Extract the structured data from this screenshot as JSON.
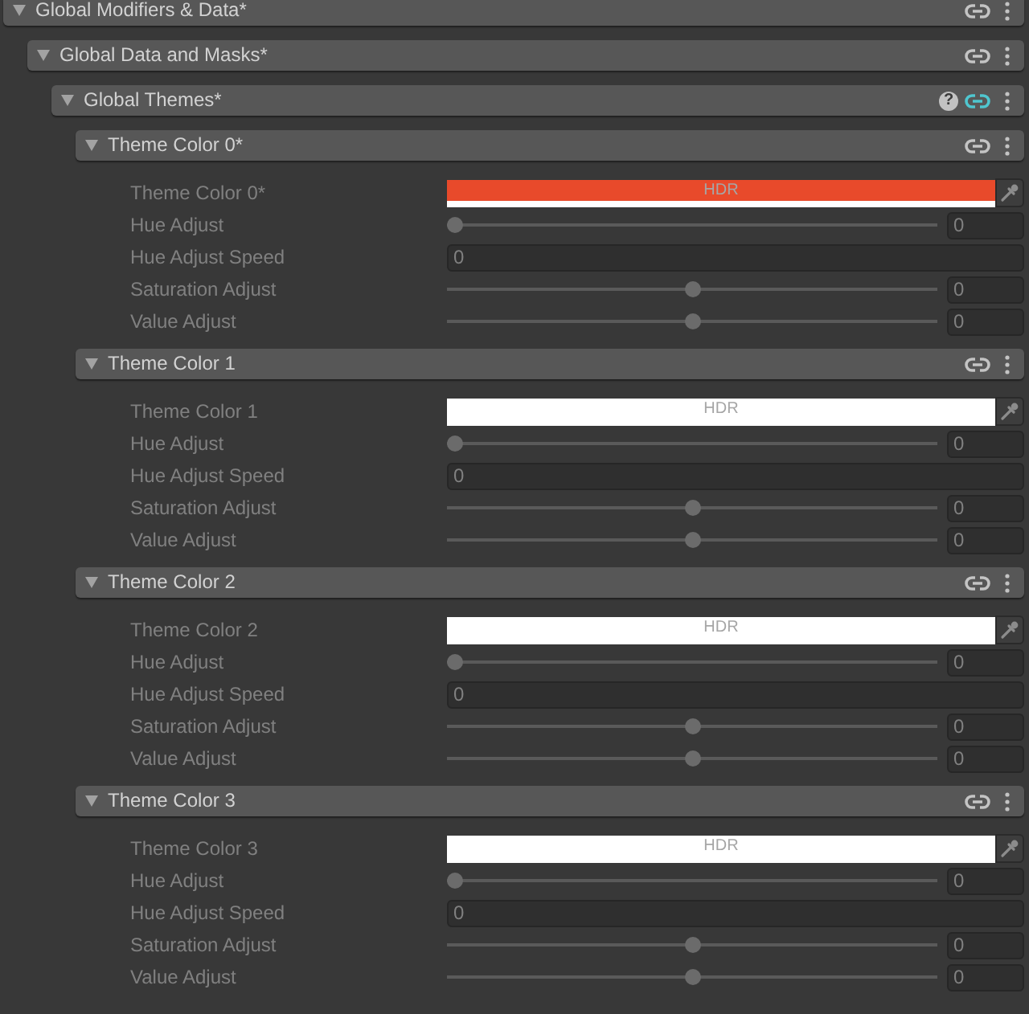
{
  "foldouts": [
    {
      "title": "Global Modifiers & Data*",
      "expanded": true,
      "linked": false,
      "children": [
        {
          "title": "Global Data and Masks*",
          "expanded": true,
          "linked": false,
          "children": [
            {
              "title": "Global Themes*",
              "expanded": true,
              "linked": true,
              "help": "?",
              "children": [
                {
                  "title": "Theme Color 0*",
                  "expanded": true,
                  "linked": false,
                  "disabled": true,
                  "properties": [
                    {
                      "kind": "color",
                      "label": "Theme Color 0*",
                      "color": "#e84a2b",
                      "badge": "HDR"
                    },
                    {
                      "kind": "slider",
                      "label": "Hue Adjust",
                      "level": 0,
                      "value": "0"
                    },
                    {
                      "kind": "number",
                      "label": "Hue Adjust Speed",
                      "value": "0"
                    },
                    {
                      "kind": "slider",
                      "label": "Saturation Adjust",
                      "level": 0.5,
                      "value": "0"
                    },
                    {
                      "kind": "slider",
                      "label": "Value Adjust",
                      "level": 0.5,
                      "value": "0"
                    }
                  ]
                },
                {
                  "title": "Theme Color 1",
                  "expanded": true,
                  "linked": false,
                  "disabled": true,
                  "properties": [
                    {
                      "kind": "color",
                      "label": "Theme Color 1",
                      "color": "#ffffff",
                      "badge": "HDR"
                    },
                    {
                      "kind": "slider",
                      "label": "Hue Adjust",
                      "level": 0,
                      "value": "0"
                    },
                    {
                      "kind": "number",
                      "label": "Hue Adjust Speed",
                      "value": "0"
                    },
                    {
                      "kind": "slider",
                      "label": "Saturation Adjust",
                      "level": 0.5,
                      "value": "0"
                    },
                    {
                      "kind": "slider",
                      "label": "Value Adjust",
                      "level": 0.5,
                      "value": "0"
                    }
                  ]
                },
                {
                  "title": "Theme Color 2",
                  "expanded": true,
                  "linked": false,
                  "disabled": true,
                  "properties": [
                    {
                      "kind": "color",
                      "label": "Theme Color 2",
                      "color": "#ffffff",
                      "badge": "HDR"
                    },
                    {
                      "kind": "slider",
                      "label": "Hue Adjust",
                      "level": 0,
                      "value": "0"
                    },
                    {
                      "kind": "number",
                      "label": "Hue Adjust Speed",
                      "value": "0"
                    },
                    {
                      "kind": "slider",
                      "label": "Saturation Adjust",
                      "level": 0.5,
                      "value": "0"
                    },
                    {
                      "kind": "slider",
                      "label": "Value Adjust",
                      "level": 0.5,
                      "value": "0"
                    }
                  ]
                },
                {
                  "title": "Theme Color 3",
                  "expanded": true,
                  "linked": false,
                  "disabled": true,
                  "properties": [
                    {
                      "kind": "color",
                      "label": "Theme Color 3",
                      "color": "#ffffff",
                      "badge": "HDR"
                    },
                    {
                      "kind": "slider",
                      "label": "Hue Adjust",
                      "level": 0,
                      "value": "0"
                    },
                    {
                      "kind": "number",
                      "label": "Hue Adjust Speed",
                      "value": "0"
                    },
                    {
                      "kind": "slider",
                      "label": "Saturation Adjust",
                      "level": 0.5,
                      "value": "0"
                    },
                    {
                      "kind": "slider",
                      "label": "Value Adjust",
                      "level": 0.5,
                      "value": "0"
                    }
                  ]
                }
              ]
            }
          ]
        }
      ]
    }
  ]
}
